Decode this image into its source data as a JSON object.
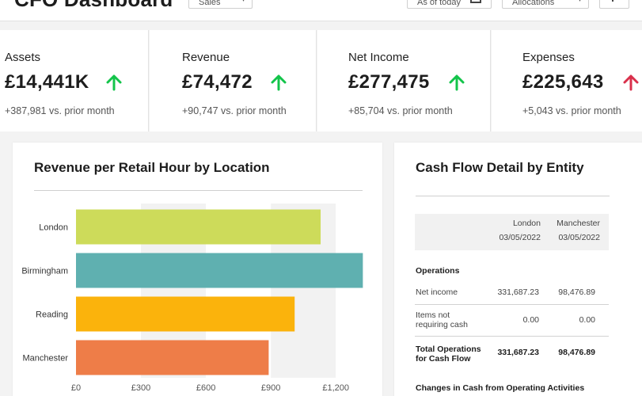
{
  "header": {
    "title": "CFO Dashboard",
    "filter_label": "Sales",
    "date_label": "As of today",
    "allocation_label": "Allocations"
  },
  "kpis": [
    {
      "label": "Assets",
      "value": "£14,441K",
      "delta": "+387,981 vs. prior month",
      "trend": "up"
    },
    {
      "label": "Revenue",
      "value": "£74,472",
      "delta": "+90,747 vs. prior month",
      "trend": "up"
    },
    {
      "label": "Net Income",
      "value": "£277,475",
      "delta": "+85,704 vs. prior month",
      "trend": "up"
    },
    {
      "label": "Expenses",
      "value": "£225,643",
      "delta": "+5,043 vs. prior month",
      "trend": "up-bad"
    }
  ],
  "colors": {
    "trend_up": "#13c44a",
    "trend_bad": "#d9304b"
  },
  "revenue_chart": {
    "title": "Revenue per Retail Hour by Location"
  },
  "chart_data": {
    "type": "bar",
    "orientation": "horizontal",
    "title": "Revenue per Retail Hour by Location",
    "categories": [
      "London",
      "Birmingham",
      "Reading",
      "Manchester"
    ],
    "values": [
      1130,
      1325,
      1010,
      890
    ],
    "colors": [
      "#cddb5a",
      "#5fb0b0",
      "#fbb30c",
      "#ee7d48"
    ],
    "xlim": [
      0,
      1320
    ],
    "xticks": [
      0,
      300,
      600,
      900,
      1200
    ],
    "xtick_labels": [
      "£0",
      "£300",
      "£600",
      "£900",
      "£1,200"
    ],
    "grid": true
  },
  "cash_flow": {
    "title": "Cash Flow Detail by Entity",
    "columns": [
      {
        "entity": "London",
        "date": "03/05/2022"
      },
      {
        "entity": "Manchester",
        "date": "03/05/2022"
      }
    ],
    "section_operations": "Operations",
    "rows": [
      {
        "label": "Net income",
        "london": "331,687.23",
        "manchester": "98,476.89",
        "bold": false
      },
      {
        "label": "Items not requiring cash",
        "london": "0.00",
        "manchester": "0.00",
        "bold": false
      },
      {
        "label": "Total Operations for Cash Flow",
        "london": "331,687.23",
        "manchester": "98,476.89",
        "bold": true
      }
    ],
    "section_changes": "Changes in Cash from Operating Activities"
  }
}
